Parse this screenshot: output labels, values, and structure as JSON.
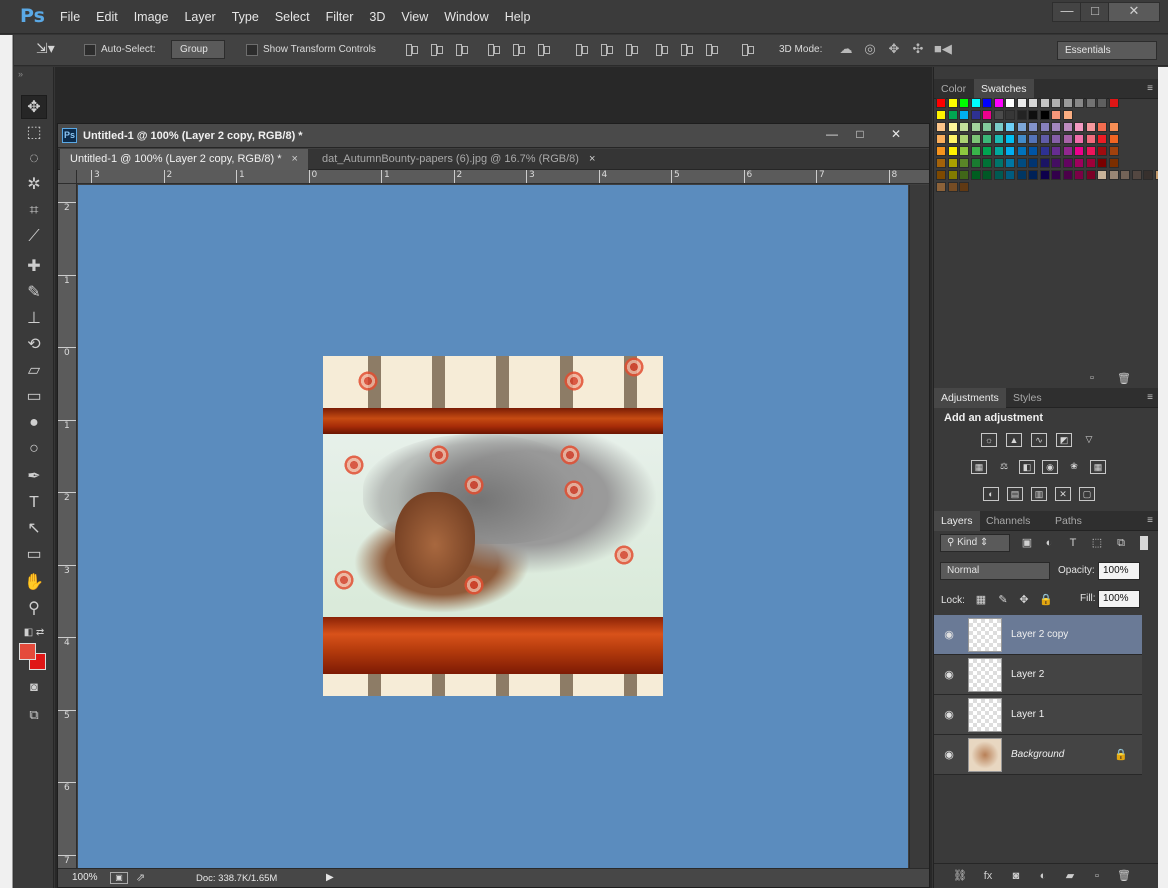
{
  "app": {
    "logo": "Ps"
  },
  "menu": [
    "File",
    "Edit",
    "Image",
    "Layer",
    "Type",
    "Select",
    "Filter",
    "3D",
    "View",
    "Window",
    "Help"
  ],
  "window_controls": {
    "minimize": "—",
    "restore": "□",
    "close": "✕"
  },
  "options_bar": {
    "auto_select_label": "Auto-Select:",
    "auto_select_value": "Group",
    "transform_label": "Show Transform Controls",
    "mode_3d_label": "3D Mode:",
    "workspace": "Essentials"
  },
  "document": {
    "title": "Untitled-1 @ 100% (Layer 2 copy, RGB/8) *",
    "tabs": [
      {
        "label": "Untitled-1 @ 100% (Layer 2 copy, RGB/8) *",
        "close": "×"
      },
      {
        "label": "dat_AutumnBounty-papers (6).jpg @ 16.7% (RGB/8)",
        "close": "×"
      }
    ],
    "ruler_top": [
      "3",
      "2",
      "1",
      "0",
      "1",
      "2",
      "3",
      "4",
      "5",
      "6",
      "7",
      "8"
    ],
    "ruler_left": [
      "2",
      "1",
      "0",
      "1",
      "2",
      "3",
      "4",
      "5",
      "6",
      "7"
    ],
    "zoom": "100%",
    "doc_size": "Doc: 338.7K/1.65M",
    "canvas_color": "#5b8cbe"
  },
  "colors": {
    "foreground": "#e54a3b",
    "background": "#e01616"
  },
  "panels": {
    "color_tabs": [
      "Color",
      "Swatches"
    ],
    "adjust_tabs": [
      "Adjustments",
      "Styles"
    ],
    "adjust_title": "Add an adjustment",
    "layer_tabs": [
      "Layers",
      "Channels",
      "Paths"
    ],
    "kind_filter": "Kind",
    "blend_mode": "Normal",
    "opacity_label": "Opacity:",
    "opacity": "100%",
    "lock_label": "Lock:",
    "fill_label": "Fill:",
    "fill": "100%",
    "layers": [
      {
        "name": "Layer 2 copy",
        "selected": true
      },
      {
        "name": "Layer 2",
        "selected": false
      },
      {
        "name": "Layer 1",
        "selected": false
      },
      {
        "name": "Background",
        "selected": false,
        "locked": true
      }
    ]
  },
  "swatches": [
    [
      "#ff0000",
      "#ffff00",
      "#00ff00",
      "#00ffff",
      "#0000ff",
      "#ff00ff",
      "#ffffff",
      "#ebebeb",
      "#d7d7d7",
      "#c3c3c3",
      "#afafaf",
      "#9b9b9b",
      "#878787",
      "#737373",
      "#5f5f5f",
      "#e01616"
    ],
    [
      "#fff200",
      "#00a651",
      "#00aeef",
      "#2e3192",
      "#ec008c",
      "#4b4b4b",
      "#373737",
      "#232323",
      "#0f0f0f",
      "#000000",
      "#f7977a",
      "#f9ad81"
    ],
    [
      "#fdc68a",
      "#fff79a",
      "#c4df9b",
      "#a3d39c",
      "#82ca9c",
      "#7accc8",
      "#6dcff6",
      "#7da7d9",
      "#8393ca",
      "#8781bd",
      "#a186be",
      "#bd8cbf",
      "#f49ac2",
      "#f6989d",
      "#f26c4f",
      "#f68e55"
    ],
    [
      "#fbaf5c",
      "#fff467",
      "#acd372",
      "#7cc576",
      "#3bb878",
      "#1abbb4",
      "#00bff3",
      "#438ccb",
      "#5574b9",
      "#605ca8",
      "#855fa8",
      "#a763a8",
      "#f06eaa",
      "#f26d7d",
      "#ed1c24",
      "#f26522"
    ],
    [
      "#f7941d",
      "#fff200",
      "#8dc73f",
      "#39b54a",
      "#00a651",
      "#00a99d",
      "#00aeef",
      "#0072bc",
      "#0054a6",
      "#2e3192",
      "#662d91",
      "#92278f",
      "#ec008c",
      "#ed145b",
      "#9e0b0f",
      "#a0410d"
    ],
    [
      "#a3620a",
      "#aba000",
      "#598527",
      "#197b30",
      "#007236",
      "#00746b",
      "#0076a3",
      "#004b80",
      "#003471",
      "#1b1464",
      "#440e62",
      "#630460",
      "#9e005d",
      "#9e0039",
      "#790000",
      "#7b2e00"
    ],
    [
      "#7d4900",
      "#827b00",
      "#406618",
      "#005e20",
      "#005826",
      "#005952",
      "#005b7f",
      "#003663",
      "#002157",
      "#0d004c",
      "#32004b",
      "#4b0049",
      "#7b0046",
      "#7a0026",
      "#c7b299",
      "#998675",
      "#736357",
      "#534741",
      "#37302d",
      "#c69c6d",
      "#a67c52"
    ],
    [
      "#8c6239",
      "#754c24",
      "#603913"
    ]
  ]
}
